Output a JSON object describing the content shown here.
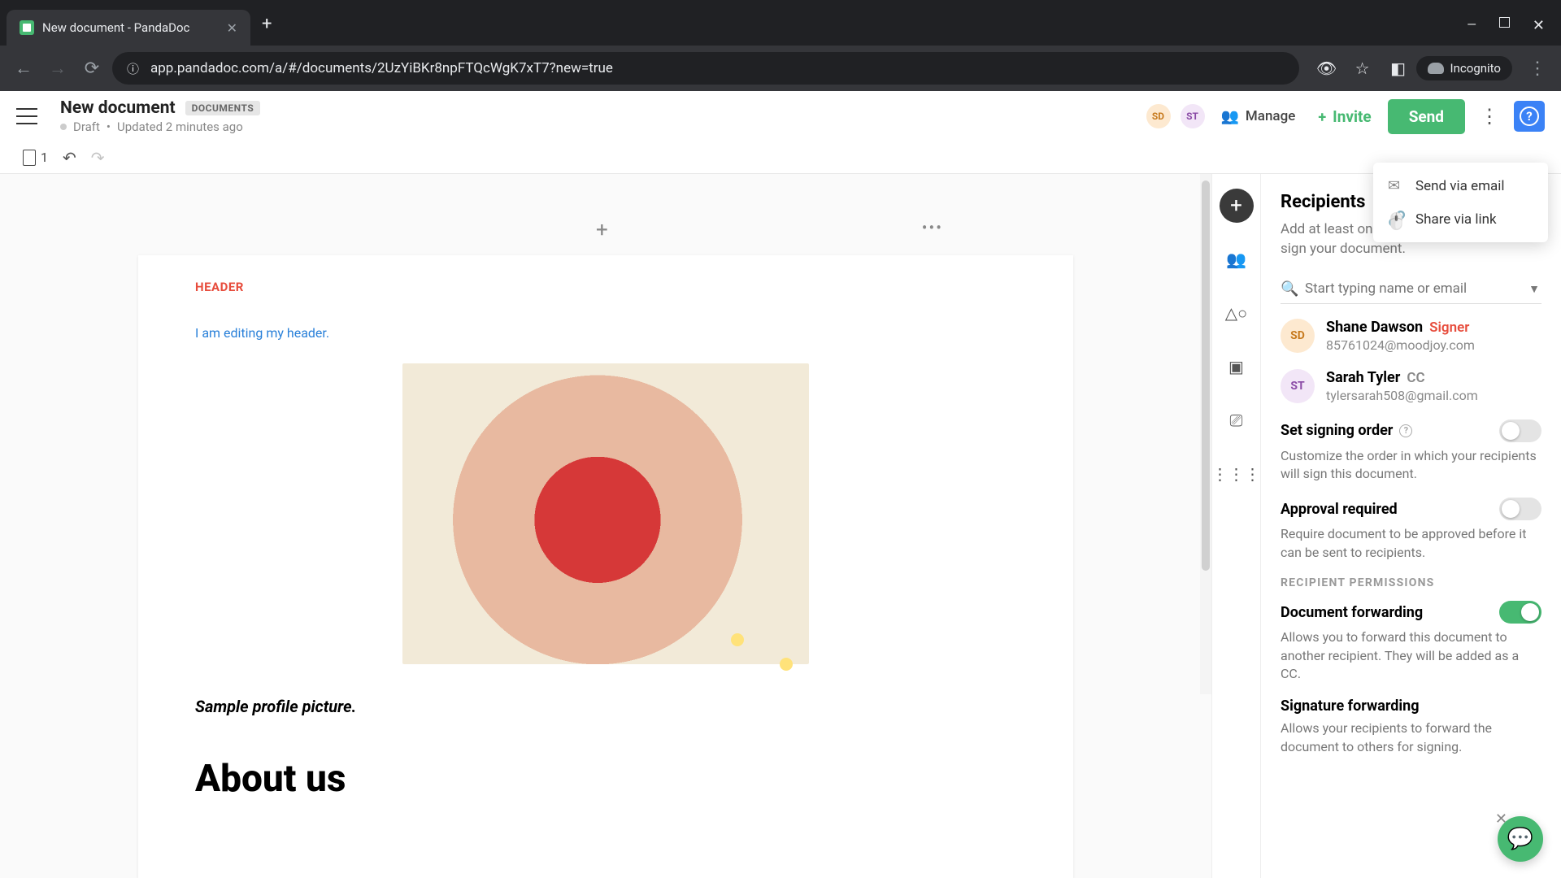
{
  "browser": {
    "tab_title": "New document - PandaDoc",
    "url": "app.pandadoc.com/a/#/documents/2UzYiBKr8npFTQcWgK7xT7?new=true",
    "incognito_label": "Incognito"
  },
  "header": {
    "title": "New document",
    "badge": "DOCUMENTS",
    "status": "Draft",
    "updated": "Updated 2 minutes ago",
    "avatars": [
      "SD",
      "ST"
    ],
    "manage_label": "Manage",
    "invite_label": "Invite",
    "send_label": "Send"
  },
  "toolbar": {
    "page_count": "1"
  },
  "document": {
    "header_label": "HEADER",
    "header_editing": "I am editing my header.",
    "caption": "Sample profile picture.",
    "about_heading": "About us"
  },
  "send_menu": {
    "email": "Send via email",
    "link": "Share via link"
  },
  "panel": {
    "title": "Recipients",
    "subtitle": "Add at least one recipient to view and/or sign your document.",
    "search_placeholder": "Start typing name or email",
    "recipients": [
      {
        "initials": "SD",
        "name": "Shane Dawson",
        "role": "Signer",
        "email": "85761024@moodjoy.com"
      },
      {
        "initials": "ST",
        "name": "Sarah Tyler",
        "role": "CC",
        "email": "tylersarah508@gmail.com"
      }
    ],
    "signing_order_label": "Set signing order",
    "signing_order_desc": "Customize the order in which your recipients will sign this document.",
    "approval_label": "Approval required",
    "approval_desc": "Require document to be approved before it can be sent to recipients.",
    "permissions_section": "RECIPIENT PERMISSIONS",
    "doc_fwd_label": "Document forwarding",
    "doc_fwd_desc": "Allows you to forward this document to another recipient. They will be added as a CC.",
    "sig_fwd_label": "Signature forwarding",
    "sig_fwd_desc": "Allows your recipients to forward the document to others for signing."
  }
}
